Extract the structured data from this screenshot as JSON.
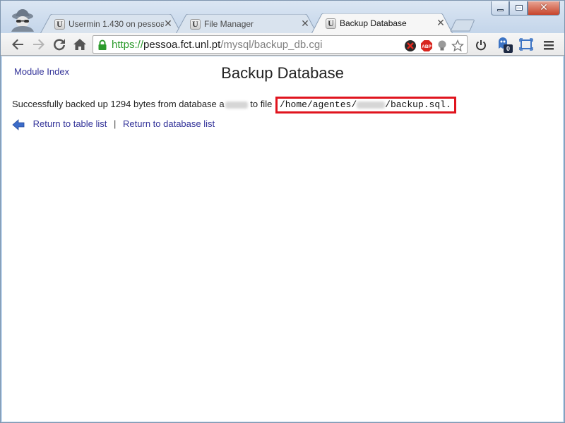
{
  "browser": {
    "tabs": [
      {
        "title": "Usermin 1.430 on pessoa (",
        "active": false
      },
      {
        "title": "File Manager",
        "active": false
      },
      {
        "title": "Backup Database",
        "active": true
      }
    ],
    "tab_favicon_letter": "U",
    "tab_close_glyph": "✕",
    "url": {
      "scheme": "https://",
      "host": "pessoa.fct.unl.pt",
      "path": "/mysql/backup_db.cgi"
    },
    "extension_badge": "0",
    "window_close_glyph": "✕"
  },
  "page": {
    "module_index": "Module Index",
    "title": "Backup Database",
    "message": {
      "prefix": "Successfully backed up 1294 bytes from database a",
      "mid": " to file ",
      "path_prefix": "/home/agentes/",
      "path_suffix": "/backup.sql",
      "end": "."
    },
    "links": {
      "table_list": "Return to table list",
      "separator": "|",
      "database_list": "Return to database list"
    }
  },
  "colors": {
    "link": "#333399",
    "highlight_border": "#e0141e",
    "url_scheme": "#2b9a2b",
    "back_arrow": "#3b6cc9"
  }
}
